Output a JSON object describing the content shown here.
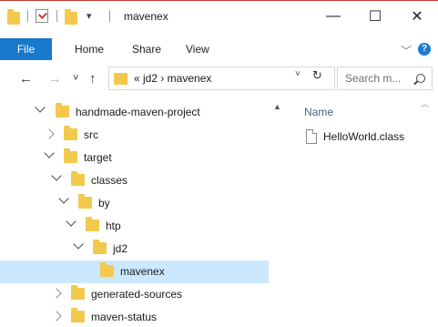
{
  "window": {
    "title": "mavenex",
    "quick_access_drop": "▾",
    "minimize": "—",
    "maximize": "☐",
    "close": "✕"
  },
  "ribbon": {
    "tabs": [
      {
        "label": "File"
      },
      {
        "label": "Home"
      },
      {
        "label": "Share"
      },
      {
        "label": "View"
      }
    ],
    "expand": "﹀",
    "help": "?"
  },
  "addressbar": {
    "back": "←",
    "forward": "→",
    "recent": "˅",
    "up": "↑",
    "path": "« jd2 › mavenex",
    "dropdown": "˅",
    "refresh": "↻"
  },
  "search": {
    "placeholder": "Search m..."
  },
  "tree": [
    {
      "label": "handmade-maven-project",
      "expanded": true
    },
    {
      "label": "src",
      "expanded": false
    },
    {
      "label": "target",
      "expanded": true
    },
    {
      "label": "classes",
      "expanded": true
    },
    {
      "label": "by",
      "expanded": true
    },
    {
      "label": "htp",
      "expanded": true
    },
    {
      "label": "jd2",
      "expanded": true
    },
    {
      "label": "mavenex",
      "expanded": null,
      "selected": true
    },
    {
      "label": "generated-sources",
      "expanded": false
    },
    {
      "label": "maven-status",
      "expanded": false
    }
  ],
  "content": {
    "column_name": "Name",
    "files": [
      {
        "name": "HelloWorld.class"
      }
    ]
  },
  "colors": {
    "accent": "#1979ca",
    "selection": "#cce8ff",
    "folder": "#f2c94c"
  }
}
